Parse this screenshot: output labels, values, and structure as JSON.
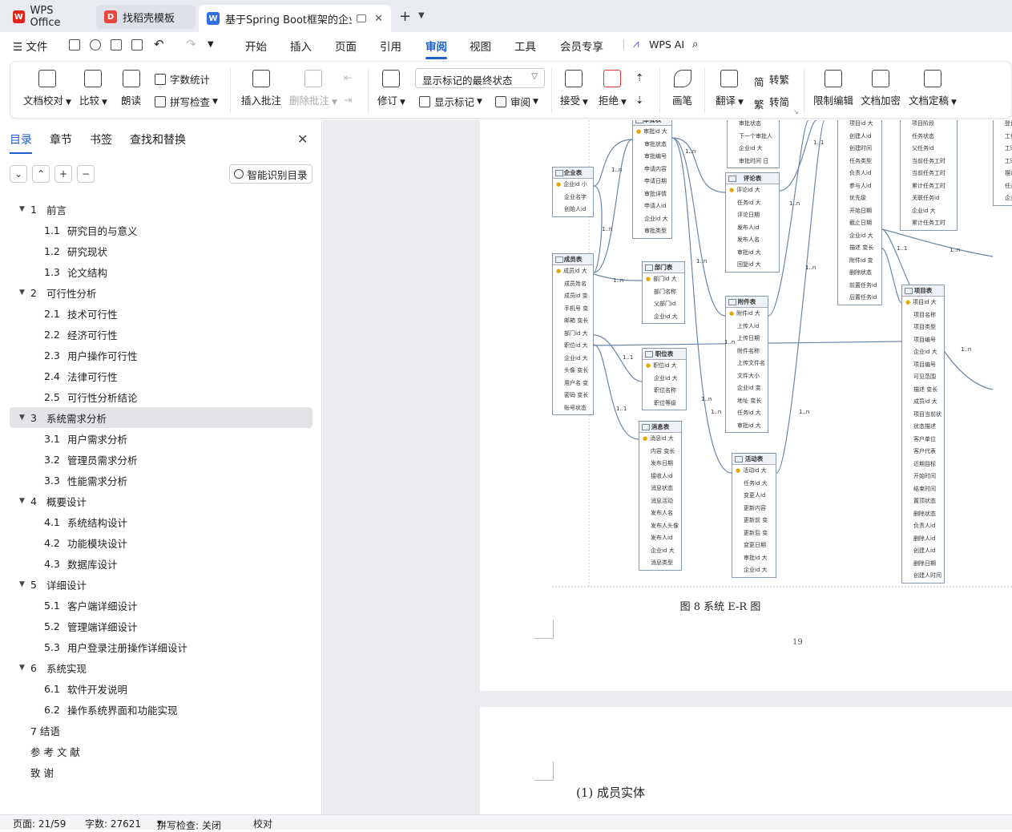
{
  "tabs": [
    {
      "title": "WPS Office",
      "icon": "W"
    },
    {
      "title": "找稻壳模板",
      "icon": "D"
    },
    {
      "title": "基于Spring Boot框架的企业项",
      "icon": "W"
    }
  ],
  "menu": {
    "file": "文件",
    "items": [
      "开始",
      "插入",
      "页面",
      "引用",
      "审阅",
      "视图",
      "工具",
      "会员专享"
    ],
    "active": "审阅",
    "wps_ai": "WPS AI"
  },
  "ribbon": {
    "doc_check": "文档校对",
    "compare": "比较",
    "read_aloud": "朗读",
    "word_count": "字数统计",
    "spell_check": "拼写检查",
    "insert_comment": "插入批注",
    "delete_comment": "删除批注",
    "revise": "修订",
    "markup_state": "显示标记的最终状态",
    "show_markup": "显示标记",
    "review": "审阅",
    "accept": "接受",
    "reject": "拒绝",
    "brush": "画笔",
    "translate": "翻译",
    "to_traditional": "转繁",
    "to_simplified": "转简",
    "restrict_edit": "限制编辑",
    "doc_encrypt": "文档加密",
    "finalize": "文档定稿"
  },
  "panel": {
    "tabs": [
      "目录",
      "章节",
      "书签",
      "查找和替换"
    ],
    "smart_toc": "智能识别目录"
  },
  "toc": [
    {
      "level": 1,
      "num": "1",
      "text": "前言"
    },
    {
      "level": 2,
      "num": "1.1",
      "text": "研究目的与意义"
    },
    {
      "level": 2,
      "num": "1.2",
      "text": "研究现状"
    },
    {
      "level": 2,
      "num": "1.3",
      "text": "论文结构"
    },
    {
      "level": 1,
      "num": "2",
      "text": "可行性分析"
    },
    {
      "level": 2,
      "num": "2.1",
      "text": "技术可行性"
    },
    {
      "level": 2,
      "num": "2.2",
      "text": "经济可行性"
    },
    {
      "level": 2,
      "num": "2.3",
      "text": "用户操作可行性"
    },
    {
      "level": 2,
      "num": "2.4",
      "text": "法律可行性"
    },
    {
      "level": 2,
      "num": "2.5",
      "text": "可行性分析结论"
    },
    {
      "level": 1,
      "num": "3",
      "text": "系统需求分析",
      "selected": true
    },
    {
      "level": 2,
      "num": "3.1",
      "text": "用户需求分析"
    },
    {
      "level": 2,
      "num": "3.2",
      "text": "管理员需求分析"
    },
    {
      "level": 2,
      "num": "3.3",
      "text": "性能需求分析"
    },
    {
      "level": 1,
      "num": "4",
      "text": "概要设计"
    },
    {
      "level": 2,
      "num": "4.1",
      "text": "系统结构设计"
    },
    {
      "level": 2,
      "num": "4.2",
      "text": "功能模块设计"
    },
    {
      "level": 2,
      "num": "4.3",
      "text": "数据库设计"
    },
    {
      "level": 1,
      "num": "5",
      "text": "详细设计"
    },
    {
      "level": 2,
      "num": "5.1",
      "text": "客户端详细设计"
    },
    {
      "level": 2,
      "num": "5.2",
      "text": "管理端详细设计"
    },
    {
      "level": 2,
      "num": "5.3",
      "text": "用户登录注册操作详细设计"
    },
    {
      "level": 1,
      "num": "6",
      "text": "系统实现"
    },
    {
      "level": 2,
      "num": "6.1",
      "text": "软件开发说明"
    },
    {
      "level": 2,
      "num": "6.2",
      "text": "操作系统界面和功能实现"
    },
    {
      "level": 0,
      "num": "",
      "text": "7   结语"
    },
    {
      "level": 0,
      "num": "",
      "text": "参  考  文  献"
    },
    {
      "level": 0,
      "num": "",
      "text": "致        谢"
    }
  ],
  "document": {
    "caption": "图 8 系统 E-R 图",
    "page_number": "19",
    "next_section": "(1)  成员实体",
    "entities": [
      {
        "name": "企业表",
        "fields": [
          "企业id 小",
          "企业名字",
          "创始人id"
        ]
      },
      {
        "name": "成员表",
        "fields": [
          "成员id 大",
          "成员姓名",
          "成员id 变",
          "手机号 变",
          "邮箱 变长",
          "部门id 大",
          "职位id 大",
          "企业id 大",
          "头像 变长",
          "用户名 变",
          "密码 变长",
          "账号状态"
        ]
      },
      {
        "name": "审批表",
        "fields": [
          "审批id 大",
          "审批状态",
          "审批编号",
          "申请内容",
          "申请日期",
          "审批详情",
          "申请人id",
          "企业id 大",
          "审批类型"
        ]
      },
      {
        "name": "部门表",
        "fields": [
          "部门id 大",
          "部门名称",
          "父部门id",
          "企业id 大"
        ]
      },
      {
        "name": "职位表",
        "fields": [
          "职位id 大",
          "企业id 大",
          "职位名称",
          "职位等级"
        ]
      },
      {
        "name": "消息表",
        "fields": [
          "消息id 大",
          "内容 变长",
          "发布日期",
          "接收人id",
          "消息状态",
          "消息活动",
          "发布人名",
          "发布人头像",
          "发布人id",
          "企业id 大",
          "消息类型"
        ]
      },
      {
        "name": "评论表",
        "fields": [
          "评论id 大",
          "任务id 大",
          "评论日期",
          "发布人id",
          "发布人名",
          "审批id 大",
          "回复id 大"
        ]
      },
      {
        "name": "附件表",
        "fields": [
          "附件id 大",
          "上传人id",
          "上传日期",
          "附件名称",
          "上传文件名",
          "文件大小",
          "企业id 变",
          "地址 变长",
          "任务id 大",
          "审批id 大"
        ]
      },
      {
        "name": "活动表",
        "fields": [
          "活动id 大",
          "任务id 大",
          "变更人id",
          "更新内容",
          "更新前 变",
          "更新后 变",
          "变更日期",
          "审批id 大",
          "企业id 大"
        ]
      },
      {
        "name": "项目表",
        "fields": [
          "项目id 大",
          "项目名称",
          "项目类型",
          "项目编号",
          "企业id 大",
          "项目编号",
          "可见范围",
          "描述 变长",
          "成员id 大",
          "项目当前状",
          "状态描述",
          "客户单位",
          "客户代表",
          "近期目标",
          "开始时间",
          "结束时间",
          "置顶状态",
          "删除状态",
          "负责人id",
          "删除人id",
          "创建人id",
          "删除日期",
          "创建人时间"
        ]
      },
      {
        "name": "",
        "fields": [
          "项目id 大",
          "创建人id",
          "创建时间",
          "任务类型",
          "负责人id",
          "参与人id",
          "优先级",
          "开始日期",
          "截止日期",
          "企业id 大",
          "描述 变长",
          "附件id 变",
          "删除状态",
          "前置任务id",
          "后置任务id"
        ]
      },
      {
        "name": "",
        "fields": [
          "审批状态",
          "下一个审批人",
          "企业id 大",
          "审批时间 日"
        ]
      },
      {
        "name": "",
        "fields": [
          "项目阶段",
          "任务状态",
          "父任务id",
          "当前任务工时",
          "当前任务工时",
          "累计任务工时",
          "关联任务id",
          "企业id 大",
          "累计任务工时"
        ]
      },
      {
        "name": "",
        "fields": [
          "登记人",
          "工作日",
          "工时",
          "工时类",
          "描述",
          "任务id",
          "企业id"
        ]
      }
    ],
    "cardinalities": [
      "1..n",
      "1..n",
      "1..n",
      "1..1",
      "1..1",
      "1..n",
      "1..n",
      "1..n",
      "1..n",
      "1..n",
      "1..n",
      "1..n",
      "1..n",
      "1..1",
      "1..1",
      "1..n",
      "1..n"
    ]
  },
  "status": {
    "page": "页面: 21/59",
    "words": "字数: 27621",
    "spell": "拼写检查: 关闭",
    "proof": "校对"
  },
  "colors": {
    "accent": "#1b5fcf",
    "wps_red": "#e2231a",
    "docer_red": "#e8453c"
  }
}
